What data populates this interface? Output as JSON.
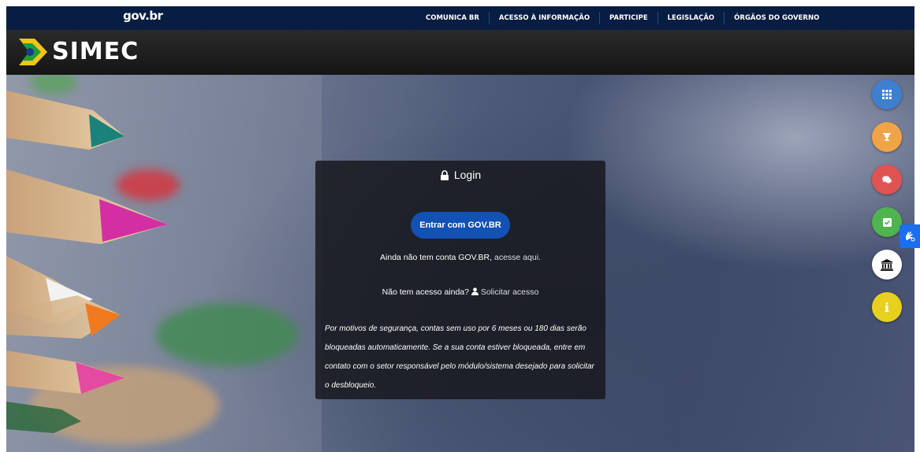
{
  "govbar": {
    "logo": "gov.br",
    "nav": [
      "COMUNICA BR",
      "ACESSO À INFORMAÇÃO",
      "PARTICIPE",
      "LEGISLAÇÃO",
      "ÓRGÃOS DO GOVERNO"
    ]
  },
  "simec": {
    "logo_text": "SIMEC"
  },
  "login": {
    "title": "Login",
    "gov_button": "Entrar com  GOV.BR",
    "no_account_prefix": "Ainda não tem conta GOV.BR, ",
    "no_account_link": "acesse aqui.",
    "no_access_prefix": "Não tem acesso ainda? ",
    "request_access_link": "Solicitar acesso",
    "notice": "Por motivos de segurança, contas sem uso por 6 meses ou 180 dias serão bloqueadas automaticamente. Se a sua conta estiver bloqueada, entre em contato com o setor responsável pelo módulo/sistema desejado para solicitar o desbloqueio."
  },
  "side_buttons": [
    {
      "icon": "grid-icon",
      "color": "#3f7fd0"
    },
    {
      "icon": "trophy-icon",
      "color": "#f0a447"
    },
    {
      "icon": "chat-icon",
      "color": "#e05353"
    },
    {
      "icon": "check-square-icon",
      "color": "#4fb34f"
    },
    {
      "icon": "bank-icon",
      "color": "#ffffff"
    },
    {
      "icon": "info-icon",
      "color": "#e8d020"
    }
  ],
  "accessibility": {
    "icon": "sign-language-icon",
    "color": "#1a6ef0"
  }
}
